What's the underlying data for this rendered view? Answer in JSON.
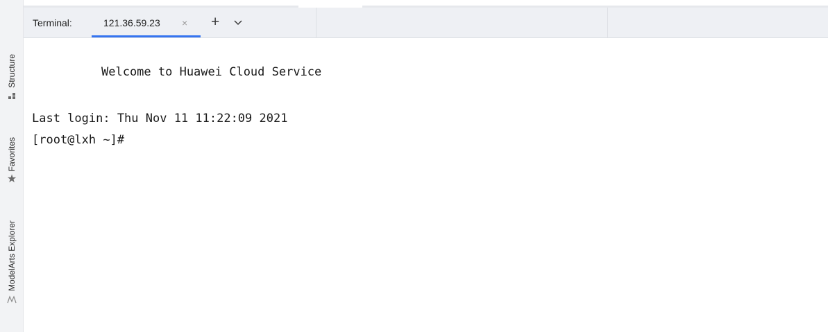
{
  "sidebar": {
    "tabs": [
      {
        "label": "Structure",
        "icon": "structure-icon"
      },
      {
        "label": "Favorites",
        "icon": "star-icon"
      },
      {
        "label": "ModelArts Explorer",
        "icon": "modelarts-icon"
      }
    ]
  },
  "terminal_panel": {
    "title": "Terminal:",
    "tabs": [
      {
        "label": "121.36.59.23",
        "active": true
      }
    ],
    "close_glyph": "×",
    "add_glyph": "+",
    "accent_color": "#3574f0"
  },
  "terminal_output": {
    "welcome": "Welcome to Huawei Cloud Service",
    "last_login": "Last login: Thu Nov 11 11:22:09 2021",
    "prompt": "[root@lxh ~]#"
  }
}
